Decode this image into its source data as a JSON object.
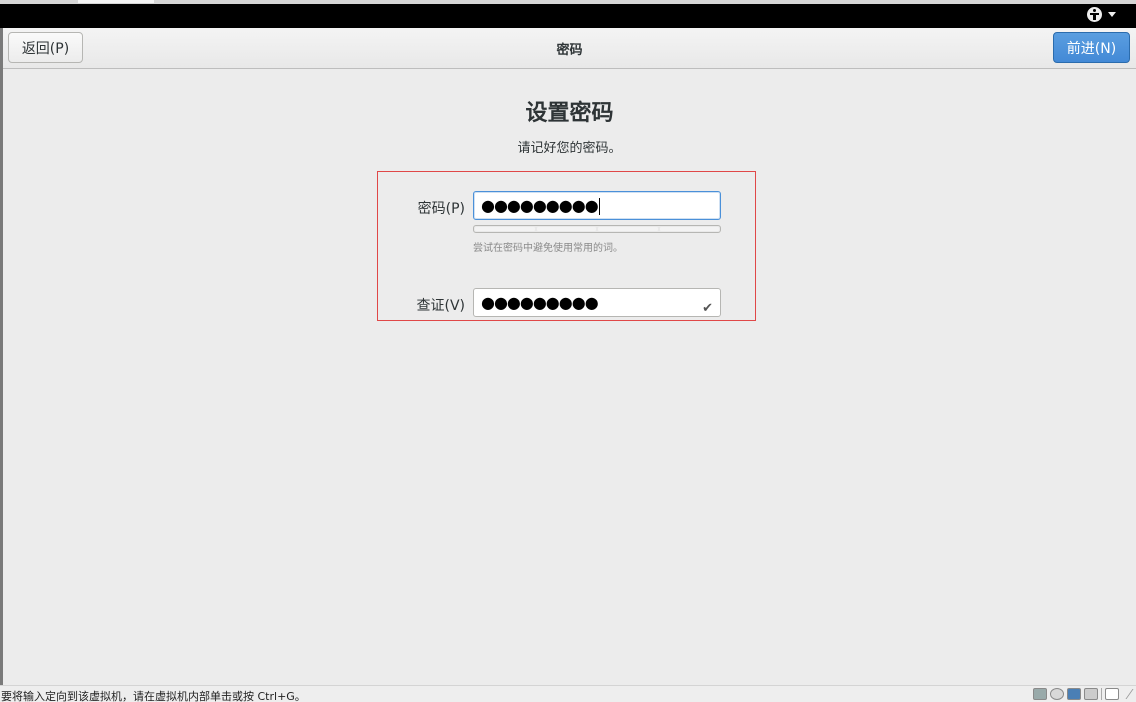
{
  "header": {
    "back_label": "返回(P)",
    "title": "密码",
    "next_label": "前进(N)"
  },
  "page": {
    "title": "设置密码",
    "subtitle": "请记好您的密码。"
  },
  "form": {
    "password_label": "密码(P)",
    "password_value": "●●●●●●●●●",
    "strength_hint": "尝试在密码中避免使用常用的词。",
    "verify_label": "查证(V)",
    "verify_value": "●●●●●●●●●",
    "verify_icon": "check-icon"
  },
  "status_bar": {
    "text": "要将输入定向到该虚拟机，请在虚拟机内部单击或按 Ctrl+G。",
    "icons": [
      "hard-disk-icon",
      "cd-rom-icon",
      "network-icon",
      "shared-folder-icon",
      "message-icon"
    ]
  },
  "colors": {
    "next_button": "#4a8fd8",
    "focus_border": "#4a90d9",
    "highlight_box": "#e04848"
  }
}
